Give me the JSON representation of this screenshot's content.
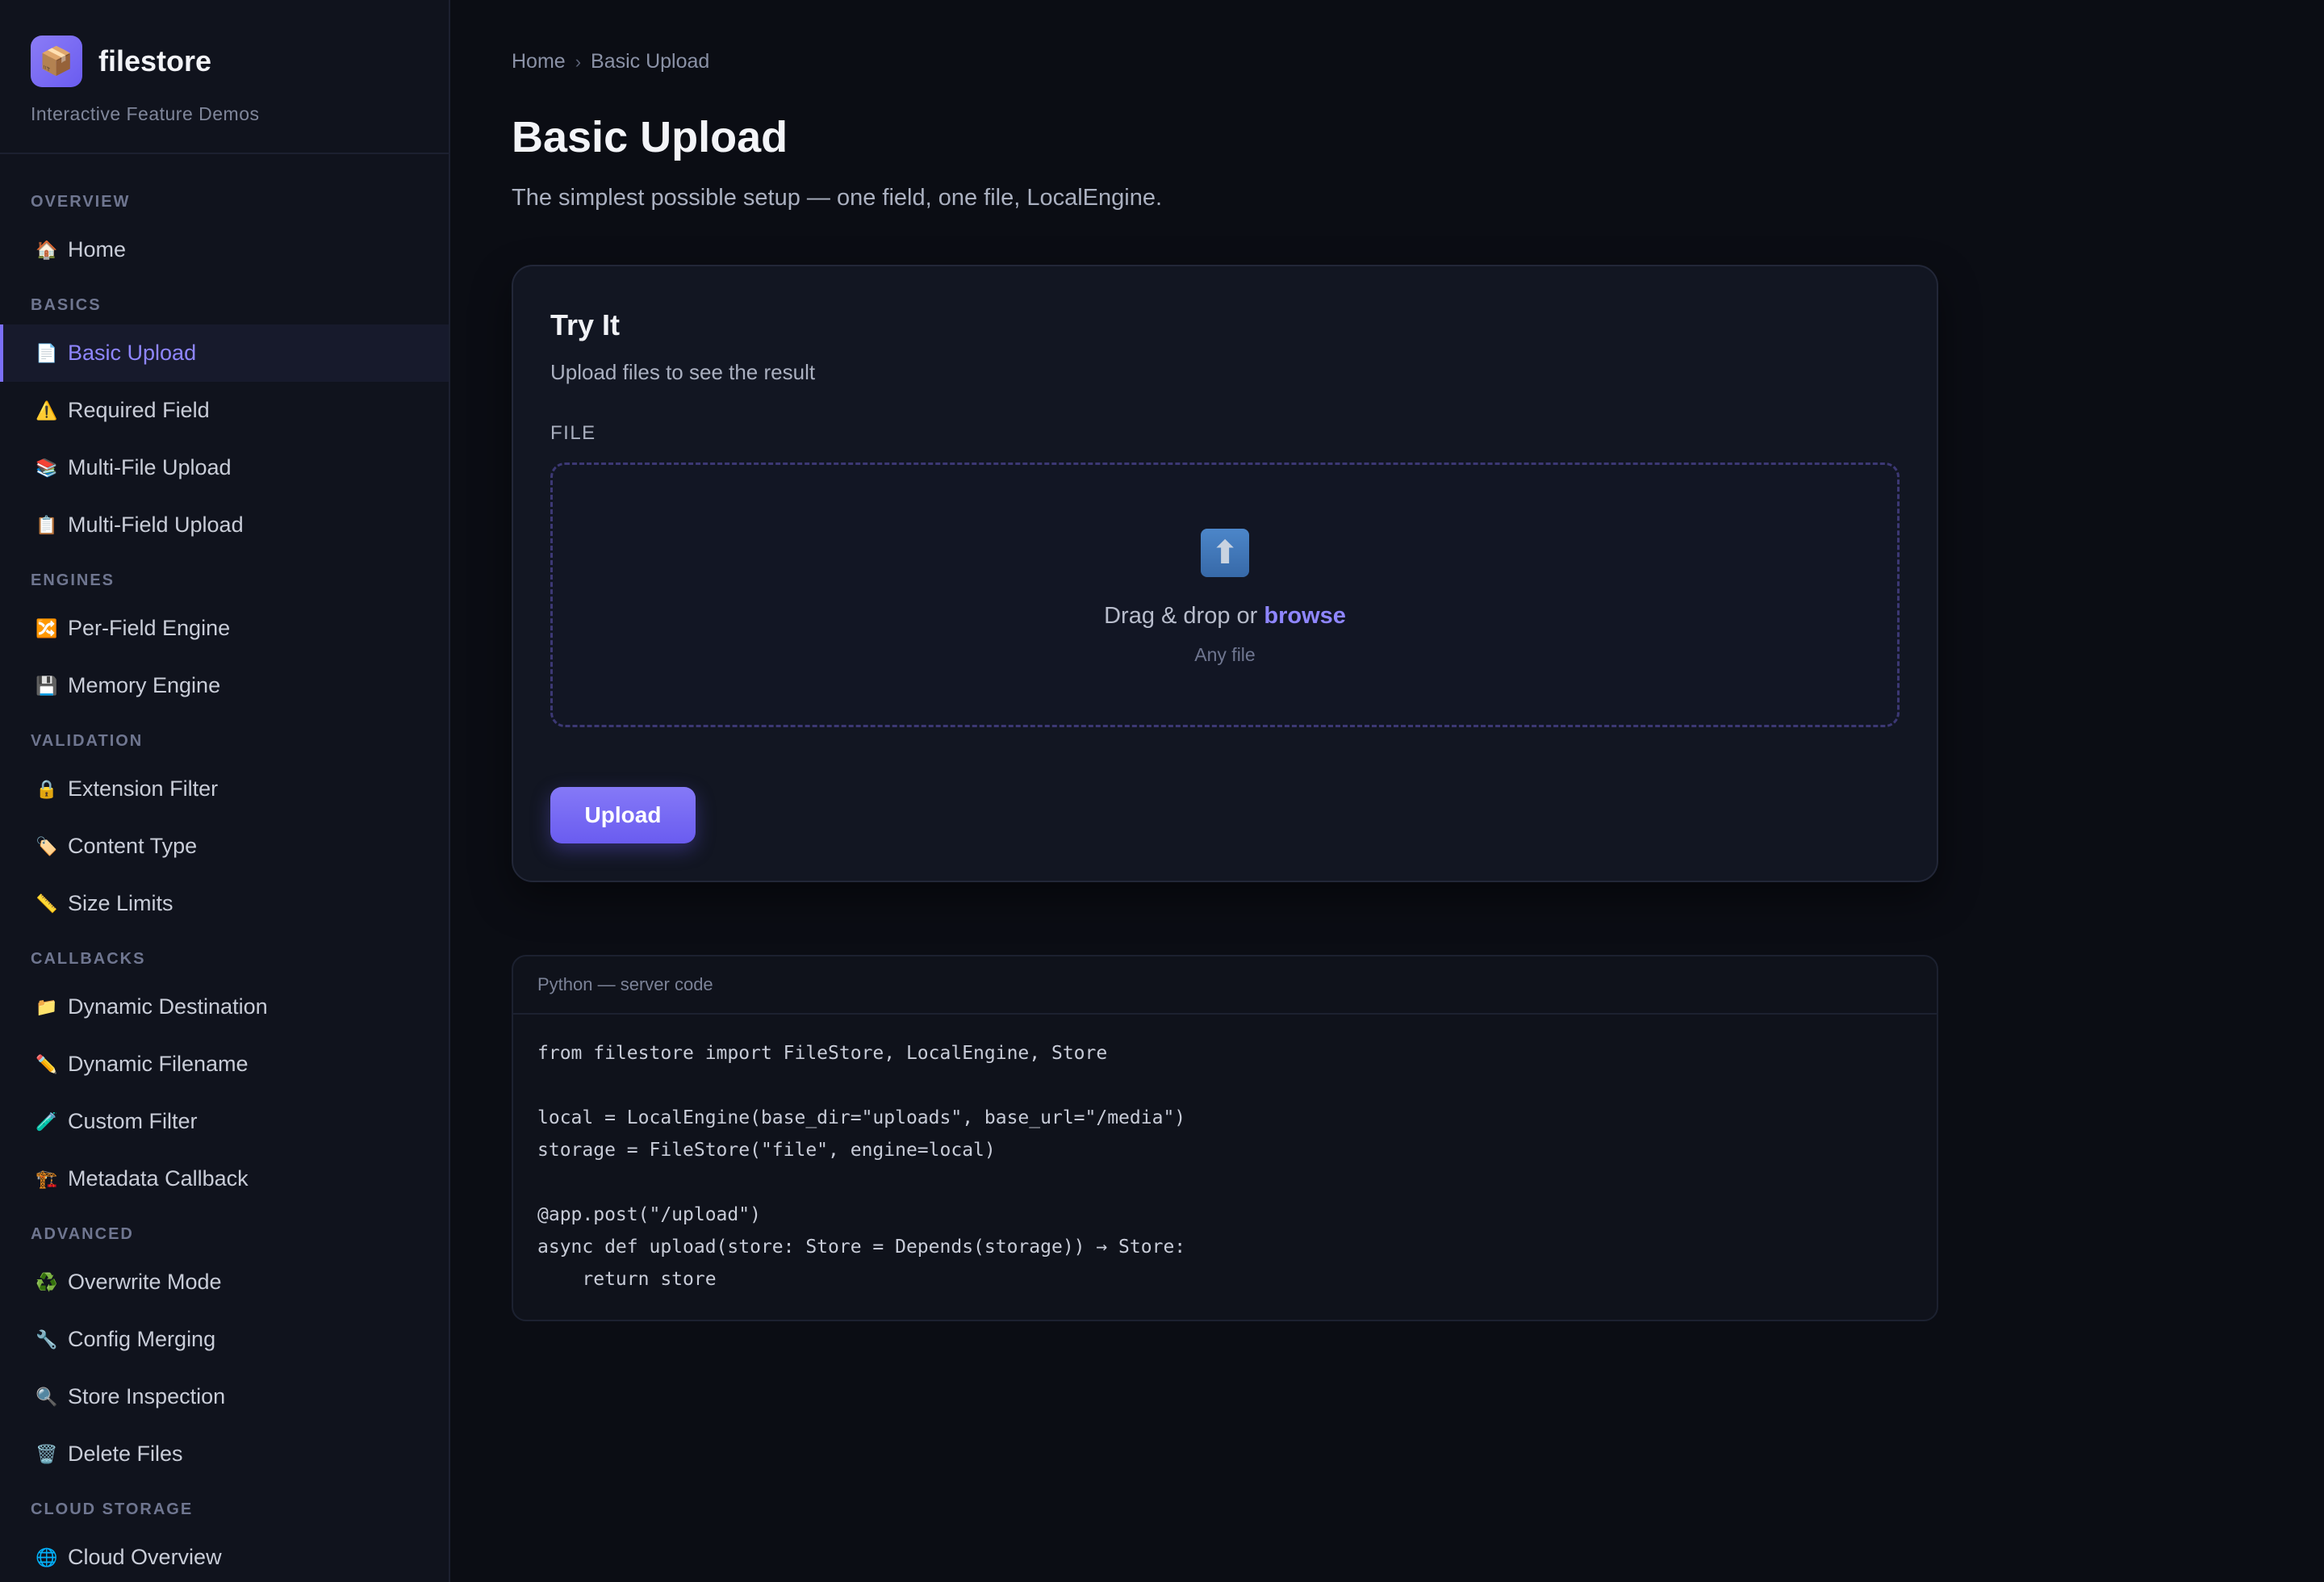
{
  "brand": {
    "logo_icon": "📦",
    "name": "filestore",
    "subtitle": "Interactive Feature Demos"
  },
  "sidebar": {
    "sections": [
      {
        "label": "OVERVIEW",
        "items": [
          {
            "icon": "🏠",
            "label": "Home"
          }
        ]
      },
      {
        "label": "BASICS",
        "items": [
          {
            "icon": "📄",
            "label": "Basic Upload",
            "active": true
          },
          {
            "icon": "⚠️",
            "label": "Required Field"
          },
          {
            "icon": "📚",
            "label": "Multi-File Upload"
          },
          {
            "icon": "📋",
            "label": "Multi-Field Upload"
          }
        ]
      },
      {
        "label": "ENGINES",
        "items": [
          {
            "icon": "🔀",
            "label": "Per-Field Engine"
          },
          {
            "icon": "💾",
            "label": "Memory Engine"
          }
        ]
      },
      {
        "label": "VALIDATION",
        "items": [
          {
            "icon": "🔒",
            "label": "Extension Filter"
          },
          {
            "icon": "🏷️",
            "label": "Content Type"
          },
          {
            "icon": "📏",
            "label": "Size Limits"
          }
        ]
      },
      {
        "label": "CALLBACKS",
        "items": [
          {
            "icon": "📁",
            "label": "Dynamic Destination"
          },
          {
            "icon": "✏️",
            "label": "Dynamic Filename"
          },
          {
            "icon": "🧪",
            "label": "Custom Filter"
          },
          {
            "icon": "🏗️",
            "label": "Metadata Callback"
          }
        ]
      },
      {
        "label": "ADVANCED",
        "items": [
          {
            "icon": "♻️",
            "label": "Overwrite Mode"
          },
          {
            "icon": "🔧",
            "label": "Config Merging"
          },
          {
            "icon": "🔍",
            "label": "Store Inspection"
          },
          {
            "icon": "🗑️",
            "label": "Delete Files"
          }
        ]
      },
      {
        "label": "CLOUD STORAGE",
        "items": [
          {
            "icon": "🌐",
            "label": "Cloud Overview"
          }
        ]
      }
    ]
  },
  "breadcrumb": {
    "home": "Home",
    "separator": "›",
    "current": "Basic Upload"
  },
  "page": {
    "title": "Basic Upload",
    "description": "The simplest possible setup — one field, one file, LocalEngine."
  },
  "try_it": {
    "title": "Try It",
    "subtitle": "Upload files to see the result",
    "field_label": "FILE",
    "dropzone": {
      "icon": "⬆",
      "text_prefix": "Drag & drop or ",
      "browse_label": "browse",
      "hint": "Any file"
    },
    "upload_label": "Upload"
  },
  "code": {
    "header": "Python — server code",
    "lines": [
      "from filestore import FileStore, LocalEngine, Store",
      "",
      "local = LocalEngine(base_dir=\"uploads\", base_url=\"/media\")",
      "storage = FileStore(\"file\", engine=local)",
      "",
      "@app.post(\"/upload\")",
      "async def upload(store: Store = Depends(storage)) → Store:",
      "    return store"
    ]
  }
}
